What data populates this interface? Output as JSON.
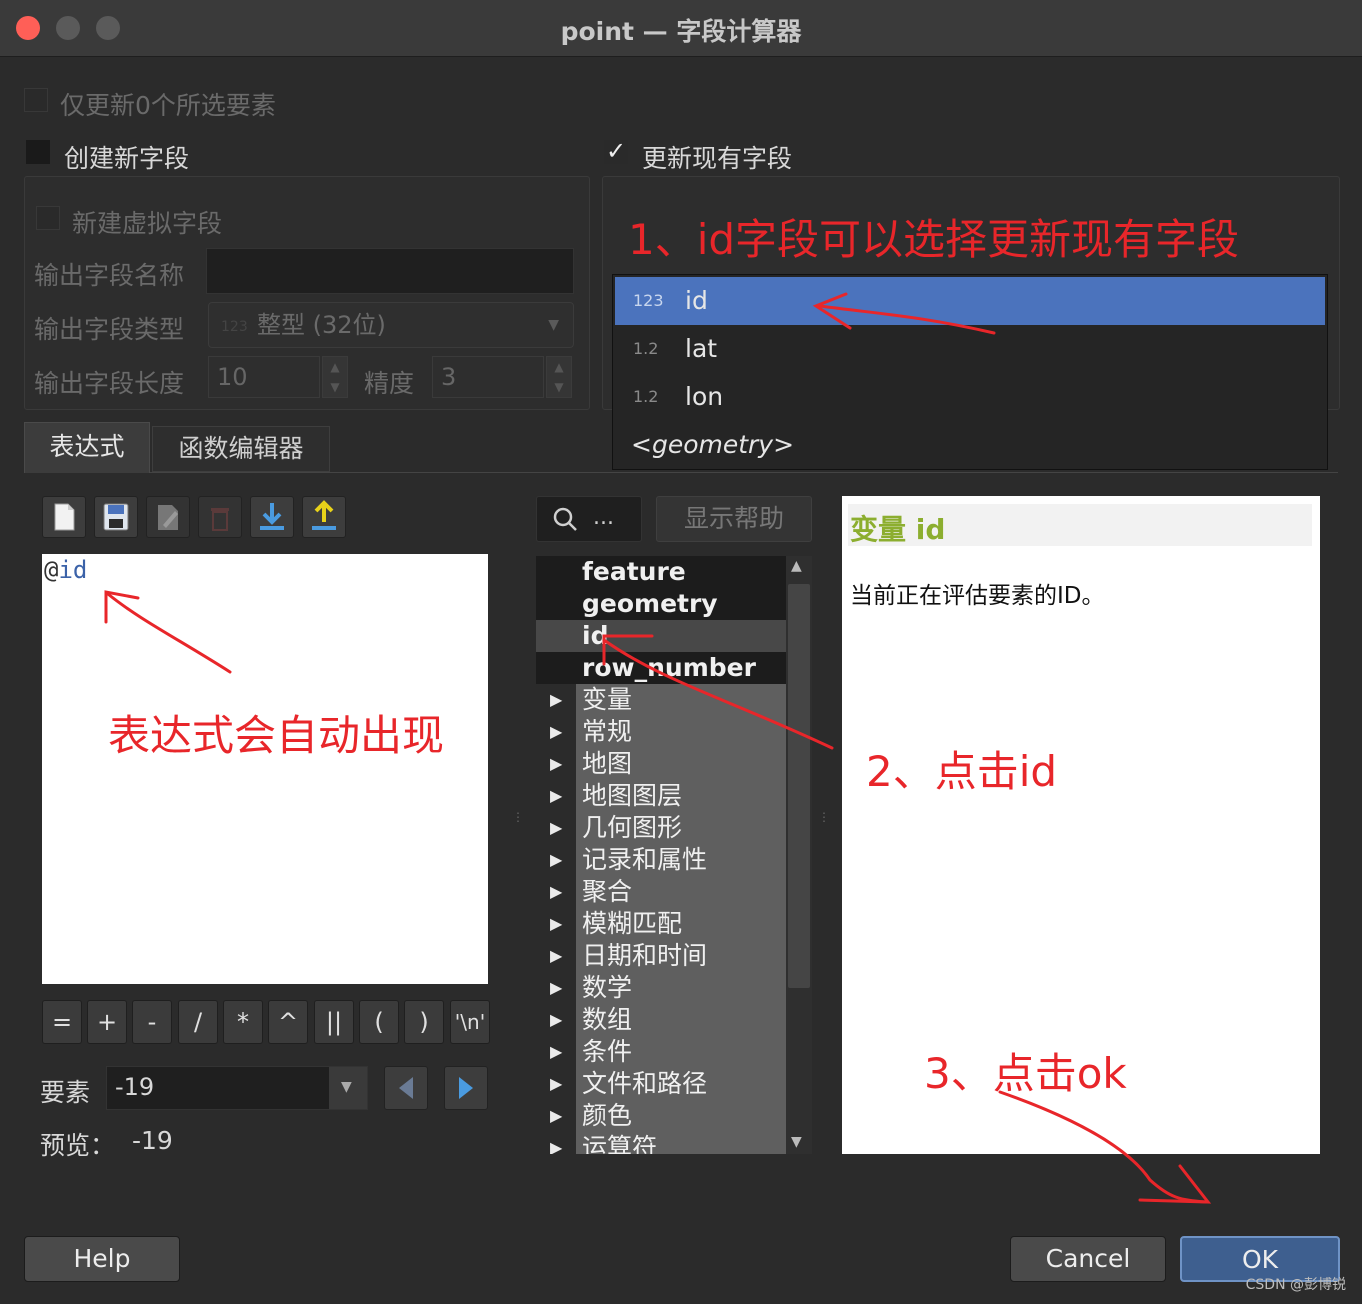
{
  "window": {
    "title": "point — 字段计算器"
  },
  "top": {
    "only_selected": "仅更新0个所选要素",
    "create_new": "创建新字段",
    "update_existing": "更新现有字段",
    "check_mark": "✓"
  },
  "new_field": {
    "virtual": "新建虚拟字段",
    "name_label": "输出字段名称",
    "type_label": "输出字段类型",
    "type_value": "整型 (32位)",
    "type_icon": "123",
    "length_label": "输出字段长度",
    "length_value": "10",
    "precision_label": "精度",
    "precision_value": "3"
  },
  "field_dropdown": {
    "items": [
      {
        "type": "123",
        "name": "id"
      },
      {
        "type": "1.2",
        "name": "lat"
      },
      {
        "type": "1.2",
        "name": "lon"
      },
      {
        "type": "",
        "name": "<geometry>"
      }
    ]
  },
  "tabs": [
    {
      "label": "表达式"
    },
    {
      "label": "函数编辑器"
    }
  ],
  "editor": {
    "at": "@",
    "name": "id"
  },
  "operators": [
    "=",
    "+",
    "-",
    "/",
    "*",
    "^",
    "||",
    "(",
    ")",
    "'\\n'"
  ],
  "feature": {
    "label": "要素",
    "value": "-19"
  },
  "preview": {
    "label": "预览：",
    "value": "-19"
  },
  "search": {
    "placeholder": "..."
  },
  "show_help": "显示帮助",
  "tree": {
    "fields": [
      "feature",
      "geometry",
      "id",
      "row_number"
    ],
    "groups": [
      "变量",
      "常规",
      "地图",
      "地图图层",
      "几何图形",
      "记录和属性",
      "聚合",
      "模糊匹配",
      "日期和时间",
      "数学",
      "数组",
      "条件",
      "文件和路径",
      "颜色",
      "运算符"
    ]
  },
  "help_panel": {
    "title_prefix": "变量",
    "title_name": "id",
    "body": "当前正在评估要素的ID。"
  },
  "buttons": {
    "help": "Help",
    "cancel": "Cancel",
    "ok": "OK"
  },
  "annotations": {
    "a1": "1、id字段可以选择更新现有字段",
    "a2": "表达式会自动出现",
    "a3": "2、点击id",
    "a4": "3、点击ok"
  },
  "watermark": "CSDN @彭博锐",
  "colors": {
    "accent": "#4b73bd",
    "annotation": "#e8262a",
    "help_title": "#8cae2f"
  }
}
